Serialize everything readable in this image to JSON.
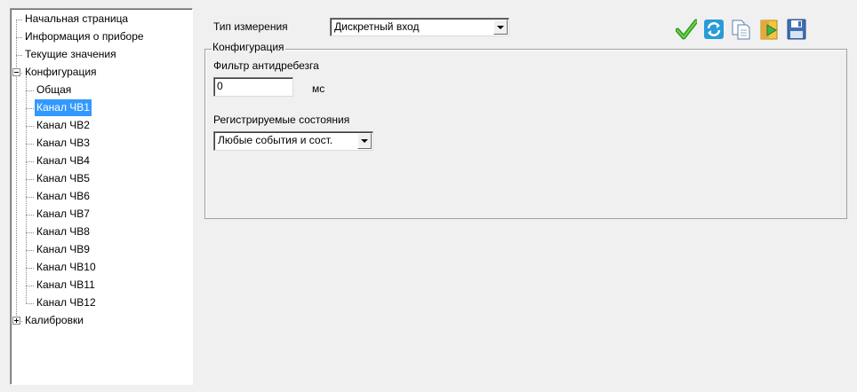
{
  "tree": {
    "items": [
      {
        "label": "Начальная страница",
        "level": 0,
        "expander": ""
      },
      {
        "label": "Информация о приборе",
        "level": 0,
        "expander": ""
      },
      {
        "label": "Текущие значения",
        "level": 0,
        "expander": ""
      },
      {
        "label": "Конфигурация",
        "level": 0,
        "expander": "minus"
      },
      {
        "label": "Общая",
        "level": 1,
        "expander": ""
      },
      {
        "label": "Канал ЧВ1",
        "level": 1,
        "expander": "",
        "selected": true
      },
      {
        "label": "Канал ЧВ2",
        "level": 1,
        "expander": ""
      },
      {
        "label": "Канал ЧВ3",
        "level": 1,
        "expander": ""
      },
      {
        "label": "Канал ЧВ4",
        "level": 1,
        "expander": ""
      },
      {
        "label": "Канал ЧВ5",
        "level": 1,
        "expander": ""
      },
      {
        "label": "Канал ЧВ6",
        "level": 1,
        "expander": ""
      },
      {
        "label": "Канал ЧВ7",
        "level": 1,
        "expander": ""
      },
      {
        "label": "Канал ЧВ8",
        "level": 1,
        "expander": ""
      },
      {
        "label": "Канал ЧВ9",
        "level": 1,
        "expander": ""
      },
      {
        "label": "Канал ЧВ10",
        "level": 1,
        "expander": ""
      },
      {
        "label": "Канал ЧВ11",
        "level": 1,
        "expander": ""
      },
      {
        "label": "Канал ЧВ12",
        "level": 1,
        "expander": ""
      },
      {
        "label": "Калибровки",
        "level": 0,
        "expander": "plus"
      }
    ]
  },
  "measurement": {
    "label": "Тип измерения",
    "value": "Дискретный вход"
  },
  "config_group": {
    "title": "Конфигурация",
    "filter_label": "Фильтр антидребезга",
    "filter_value": "0",
    "filter_unit": "мс",
    "states_label": "Регистрируемые состояния",
    "states_value": "Любые события и сост."
  },
  "toolbar": {
    "icons": [
      "apply-check-icon",
      "refresh-icon",
      "copy-icon",
      "export-icon",
      "save-disk-icon"
    ]
  },
  "colors": {
    "background": "#f0f0f0",
    "selection": "#3399ff"
  }
}
